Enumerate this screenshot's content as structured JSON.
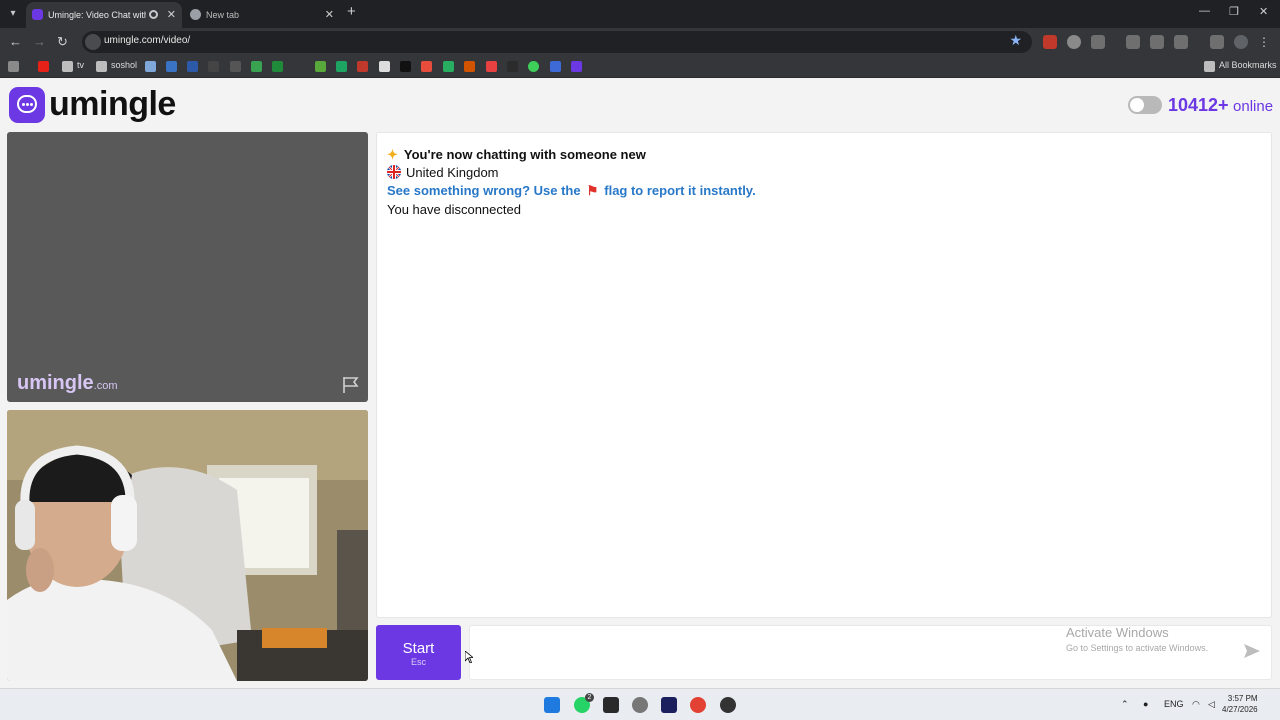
{
  "browser": {
    "tabs": [
      {
        "title": "Umingle: Video Chat with S",
        "active": true
      },
      {
        "title": "New tab",
        "active": false
      }
    ],
    "url": "umingle.com/video/",
    "bookmarks": {
      "folder1": "tv",
      "folder2": "soshol",
      "all": "All Bookmarks"
    }
  },
  "header": {
    "logo": "umingle",
    "online_count": "10412+",
    "online_label": "online"
  },
  "stranger_video": {
    "watermark_main": "umingle",
    "watermark_suffix": ".com"
  },
  "chat": {
    "messages": [
      {
        "text": "You're now chatting with someone new",
        "icon": "sparkles-icon"
      },
      {
        "text": "United Kingdom",
        "icon": "uk-flag-icon"
      },
      {
        "text_before": "See something wrong? Use the",
        "text_after": "flag to report it instantly.",
        "icon": "red-flag-icon"
      },
      {
        "text": "You have disconnected"
      }
    ]
  },
  "controls": {
    "start_label": "Start",
    "start_hint": "Esc"
  },
  "windows_notice": {
    "line1": "Activate Windows",
    "line2": "Go to Settings to activate Windows."
  },
  "taskbar": {
    "lang": "ENG",
    "time": "3:57 PM",
    "date": "4/27/2026",
    "whatsapp_badge": "2"
  },
  "colors": {
    "brand": "#6c38e3",
    "link": "#2878c8"
  }
}
